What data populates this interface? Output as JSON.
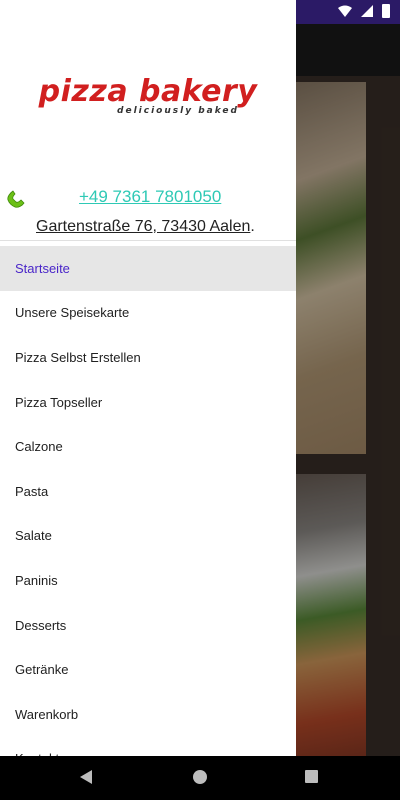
{
  "brand": {
    "name": "pizza bakery",
    "tagline": "deliciously baked",
    "color": "#d11f1f"
  },
  "contact": {
    "phone": "+49 7361 7801050",
    "address": "Gartenstraße 76, 73430 Aalen",
    "address_suffix": "."
  },
  "menu": {
    "items": [
      {
        "label": "Startseite",
        "active": true
      },
      {
        "label": "Unsere Speisekarte"
      },
      {
        "label": "Pizza Selbst Erstellen"
      },
      {
        "label": "Pizza Topseller"
      },
      {
        "label": "Calzone"
      },
      {
        "label": "Pasta"
      },
      {
        "label": "Salate"
      },
      {
        "label": "Paninis"
      },
      {
        "label": "Desserts"
      },
      {
        "label": "Getränke"
      },
      {
        "label": "Warenkorb"
      },
      {
        "label": "Kontakt"
      }
    ]
  },
  "colors": {
    "status_bar": "#2b1a66",
    "active_item_text": "#4a26c9",
    "phone_link": "#2ec9b5"
  },
  "icons": {
    "phone": "phone-icon",
    "status": [
      "wifi-icon",
      "signal-icon",
      "battery-icon"
    ],
    "nav": [
      "back-icon",
      "home-icon",
      "recents-icon"
    ]
  }
}
